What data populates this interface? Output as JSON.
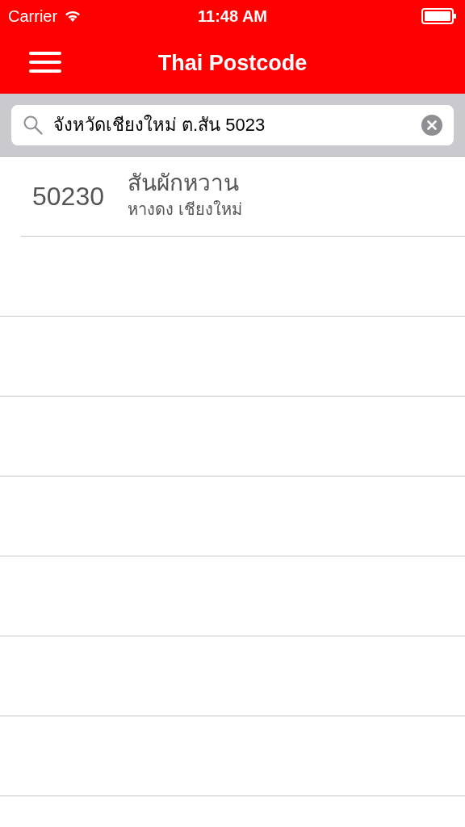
{
  "status_bar": {
    "carrier": "Carrier",
    "time": "11:48 AM"
  },
  "nav_bar": {
    "title": "Thai Postcode"
  },
  "search": {
    "value": "จังหวัดเชียงใหม่ ต.สัน 5023"
  },
  "results": [
    {
      "postcode": "50230",
      "subdistrict": "สันผักหวาน",
      "location": "หางดง เชียงใหม่"
    }
  ]
}
